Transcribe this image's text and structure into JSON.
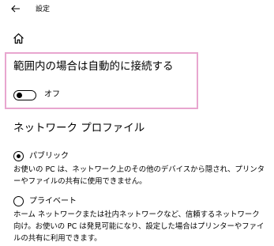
{
  "header": {
    "back_icon": "back-arrow-icon",
    "title": "設定"
  },
  "nav": {
    "home_icon": "home-icon"
  },
  "auto_connect": {
    "heading": "範囲内の場合は自動的に接続する",
    "toggle_state": "off",
    "toggle_label": "オフ",
    "highlight_color": "#e8a6cf"
  },
  "network_profile": {
    "heading": "ネットワーク プロファイル",
    "options": [
      {
        "label": "パブリック",
        "selected": true,
        "description": "お使いの PC は、ネットワーク上のその他のデバイスから隠され、プリンターやファイルの共有に使用できません。"
      },
      {
        "label": "プライベート",
        "selected": false,
        "description": "ホーム ネットワークまたは社内ネットワークなど、信頼するネットワーク向け。お使いの PC は発見可能になり、設定した場合はプリンターやファイルの共有に利用できます。"
      }
    ]
  }
}
